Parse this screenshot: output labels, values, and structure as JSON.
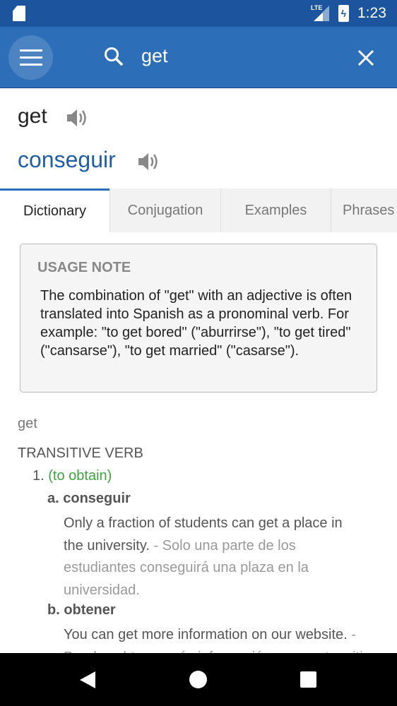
{
  "status": {
    "time": "1:23",
    "network": "LTE"
  },
  "search": {
    "query": "get"
  },
  "headword": {
    "source": "get",
    "translation": "conseguir"
  },
  "tabs": [
    {
      "label": "Dictionary"
    },
    {
      "label": "Conjugation"
    },
    {
      "label": "Examples"
    },
    {
      "label": "Phrases"
    }
  ],
  "usage_note": {
    "title": "USAGE NOTE",
    "text": "The combination of \"get\" with an adjective is often translated into Spanish as a pronominal verb. For example: \"to get bored\" (\"aburrirse\"), \"to get tired\" (\"cansarse\"), \"to get married\" (\"casarse\")."
  },
  "entry": {
    "word": "get",
    "pos": "TRANSITIVE VERB",
    "senses": [
      {
        "num": "1.",
        "gloss": "(to obtain)",
        "subs": [
          {
            "letter": "a.",
            "word": "conseguir",
            "example": "Only a fraction of students can get a place in the university.",
            "translation": " - Solo una parte de los estudiantes conseguirá una plaza en la universidad."
          },
          {
            "letter": "b.",
            "word": "obtener",
            "example": "You can get more information on our website.",
            "translation": " - Puedes obtener más información en nuestro sitio web."
          }
        ]
      }
    ]
  },
  "colors": {
    "appbar": "#2d6eb8",
    "statusbar": "#1c559e",
    "translation": "#1f5fa8",
    "gloss": "#3aa53a"
  }
}
